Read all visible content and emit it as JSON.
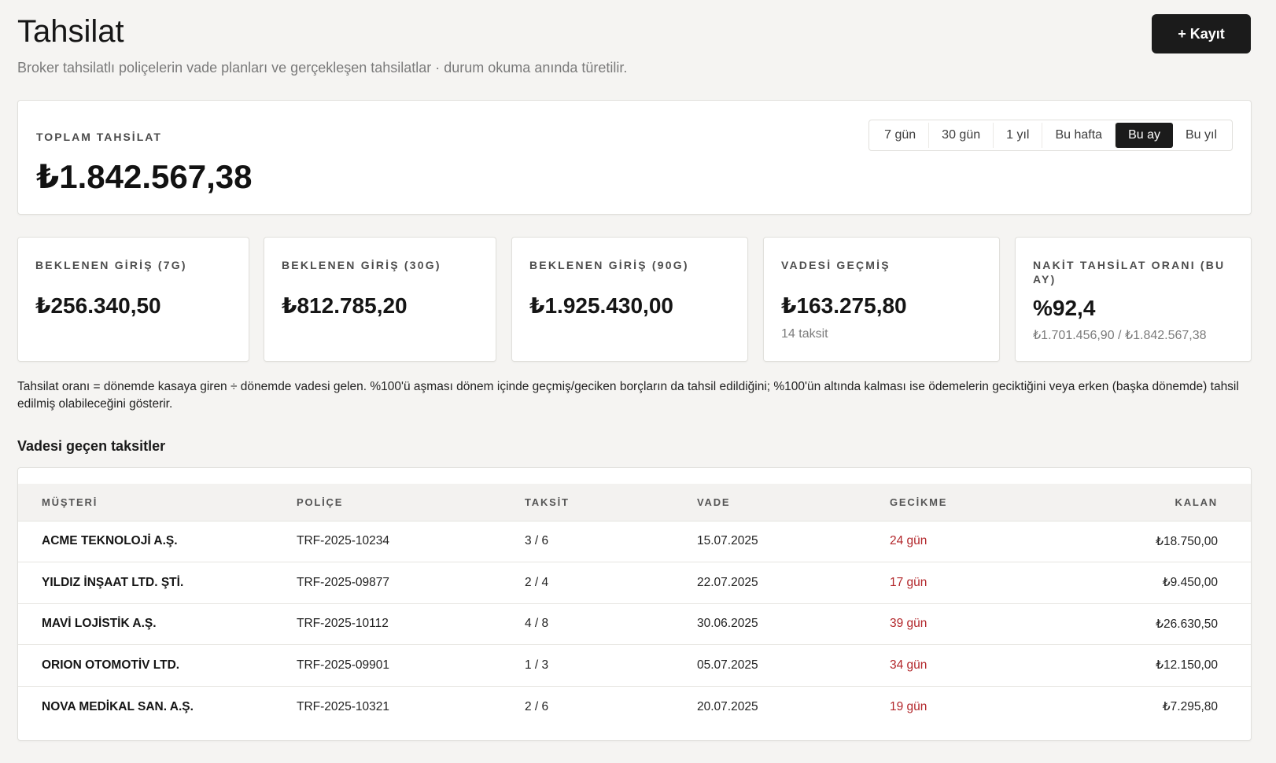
{
  "header": {
    "title": "Tahsilat",
    "subtitle": "Broker tahsilatlı poliçelerin vade planları ve gerçekleşen tahsilatlar · durum okuma anında türetilir.",
    "add_button_label": "+ Kayıt"
  },
  "total": {
    "label": "TOPLAM TAHSİLAT",
    "value": "₺1.842.567,38"
  },
  "ranges": {
    "items": [
      "7 gün",
      "30 gün",
      "1 yıl",
      "Bu hafta",
      "Bu ay",
      "Bu yıl"
    ],
    "selected": "Bu ay"
  },
  "metrics": [
    {
      "label": "BEKLENEN GİRİŞ (7G)",
      "value": "₺256.340,50",
      "sub": ""
    },
    {
      "label": "BEKLENEN GİRİŞ (30G)",
      "value": "₺812.785,20",
      "sub": ""
    },
    {
      "label": "BEKLENEN GİRİŞ (90G)",
      "value": "₺1.925.430,00",
      "sub": ""
    },
    {
      "label": "VADESİ GEÇMİŞ",
      "value": "₺163.275,80",
      "sub": "14 taksit"
    },
    {
      "label": "NAKİT TAHSİLAT ORANI (BU AY)",
      "value": "%92,4",
      "sub": "₺1.701.456,90 / ₺1.842.567,38"
    }
  ],
  "note": "Tahsilat oranı = dönemde kasaya giren ÷ dönemde vadesi gelen. %100'ü aşması dönem içinde geçmiş/geciken borçların da tahsil edildiğini; %100'ün altında kalması ise ödemelerin geciktiğini veya erken (başka dönemde) tahsil edilmiş olabileceğini gösterir.",
  "overdue": {
    "title": "Vadesi geçen taksitler",
    "columns": {
      "customer": "MÜŞTERİ",
      "policy": "POLİÇE",
      "installment": "TAKSİT",
      "due": "VADE",
      "delay": "GECİKME",
      "remaining": "KALAN"
    },
    "rows": [
      {
        "customer": "ACME TEKNOLOJİ A.Ş.",
        "policy": "TRF-2025-10234",
        "installment": "3 / 6",
        "due": "15.07.2025",
        "delay": "24 gün",
        "remaining": "₺18.750,00"
      },
      {
        "customer": "YILDIZ İNŞAAT LTD. ŞTİ.",
        "policy": "TRF-2025-09877",
        "installment": "2 / 4",
        "due": "22.07.2025",
        "delay": "17 gün",
        "remaining": "₺9.450,00"
      },
      {
        "customer": "MAVİ LOJİSTİK A.Ş.",
        "policy": "TRF-2025-10112",
        "installment": "4 / 8",
        "due": "30.06.2025",
        "delay": "39 gün",
        "remaining": "₺26.630,50"
      },
      {
        "customer": "ORION OTOMOTİV LTD.",
        "policy": "TRF-2025-09901",
        "installment": "1 / 3",
        "due": "05.07.2025",
        "delay": "34 gün",
        "remaining": "₺12.150,00"
      },
      {
        "customer": "NOVA MEDİKAL SAN. A.Ş.",
        "policy": "TRF-2025-10321",
        "installment": "2 / 6",
        "due": "20.07.2025",
        "delay": "19 gün",
        "remaining": "₺7.295,80"
      }
    ]
  },
  "colors": {
    "accent_dark": "#1b1b1b",
    "overdue_red": "#b2262a",
    "background": "#f5f4f2"
  }
}
